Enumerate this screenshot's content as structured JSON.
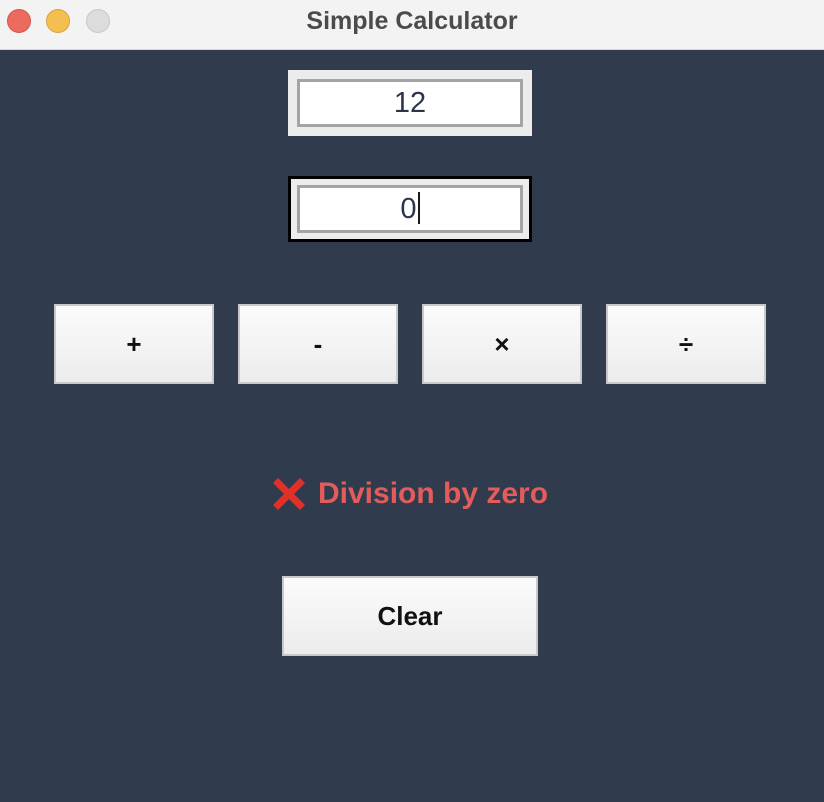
{
  "window": {
    "title": "Simple Calculator"
  },
  "inputs": {
    "first_value": "12",
    "second_value": "0"
  },
  "operators": {
    "add_label": "+",
    "subtract_label": "-",
    "multiply_label": "×",
    "divide_label": "÷"
  },
  "status": {
    "icon": "cross-mark-icon",
    "message": "Division by zero",
    "color": "#e35b5b"
  },
  "actions": {
    "clear_label": "Clear"
  },
  "colors": {
    "background": "#303c4e",
    "titlebar": "#f3f3f3",
    "error": "#e35b5b",
    "icon_red": "#e0302a"
  }
}
